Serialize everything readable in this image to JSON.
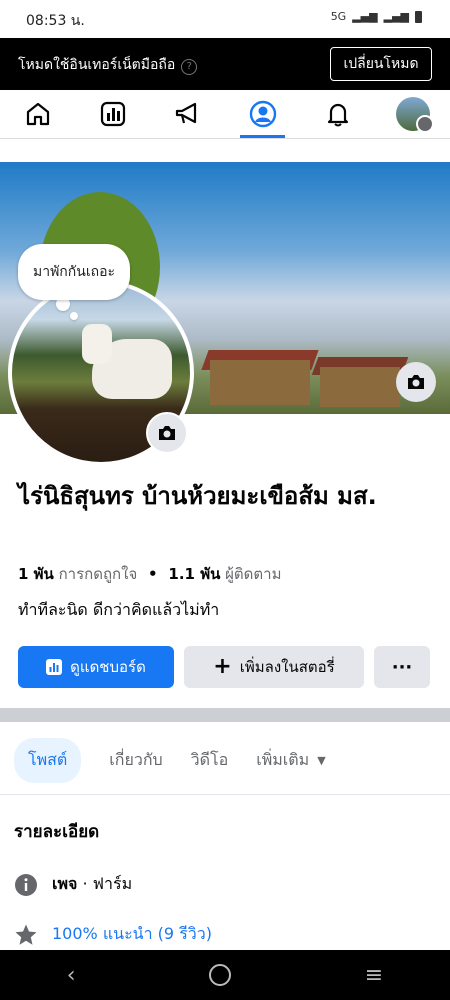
{
  "status_bar": {
    "time": "08:53 น.",
    "network": "5G"
  },
  "data_mode_banner": {
    "text": "โหมดใช้อินเทอร์เน็ตมือถือ",
    "button": "เปลี่ยนโหมด"
  },
  "nav": {
    "items": [
      "home-icon",
      "dashboard-icon",
      "megaphone-icon",
      "profile-icon",
      "bell-icon",
      "avatar-icon"
    ],
    "active": "profile"
  },
  "profile": {
    "note_bubble": "มาพักกันเถอะ",
    "name": "ไร่นิธิสุนทร บ้านห้วยมะเขือส้ม มส.",
    "likes_count": "1 พัน",
    "likes_label": "การกดถูกใจ",
    "separator": "•",
    "followers_count": "1.1 พัน",
    "followers_label": "ผู้ติดตาม",
    "bio": "ทำทีละนิด ดีกว่าคิดแล้วไม่ทำ"
  },
  "actions": {
    "dashboard": "ดูแดชบอร์ด",
    "add_story": "เพิ่มลงในสตอรี่",
    "more": "···"
  },
  "tabs": [
    "โพสต์",
    "เกี่ยวกับ",
    "วิดีโอ",
    "เพิ่มเติม"
  ],
  "details": {
    "title": "รายละเอียด",
    "page_label": "เพจ",
    "page_category": "· ฟาร์ม",
    "recommendation": "100% แนะนำ (9 รีวิว)"
  },
  "colors": {
    "accent": "#1877f2",
    "banner_bg": "#000000"
  }
}
